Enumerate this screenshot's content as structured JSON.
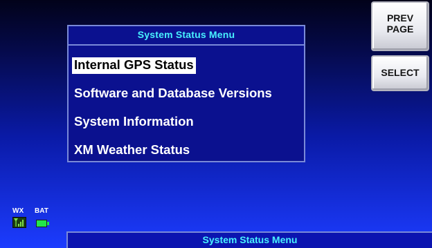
{
  "menu": {
    "title": "System Status Menu",
    "items": [
      {
        "label": "Internal GPS Status",
        "selected": true
      },
      {
        "label": "Software and Database Versions",
        "selected": false
      },
      {
        "label": "System Information",
        "selected": false
      },
      {
        "label": "XM Weather Status",
        "selected": false
      }
    ]
  },
  "softkeys": {
    "prev_page_line1": "PREV",
    "prev_page_line2": "PAGE",
    "select": "SELECT"
  },
  "status": {
    "wx_label": "WX",
    "bat_label": "BAT",
    "wx_icon": "signal-strength-icon",
    "bat_icon": "battery-icon"
  },
  "bottom_bar": {
    "title": "System Status Menu"
  },
  "colors": {
    "title_cyan": "#48f1ff",
    "selection_bg": "#ffffff",
    "menu_bg": "#0b118f",
    "battery_green": "#22e64a"
  }
}
